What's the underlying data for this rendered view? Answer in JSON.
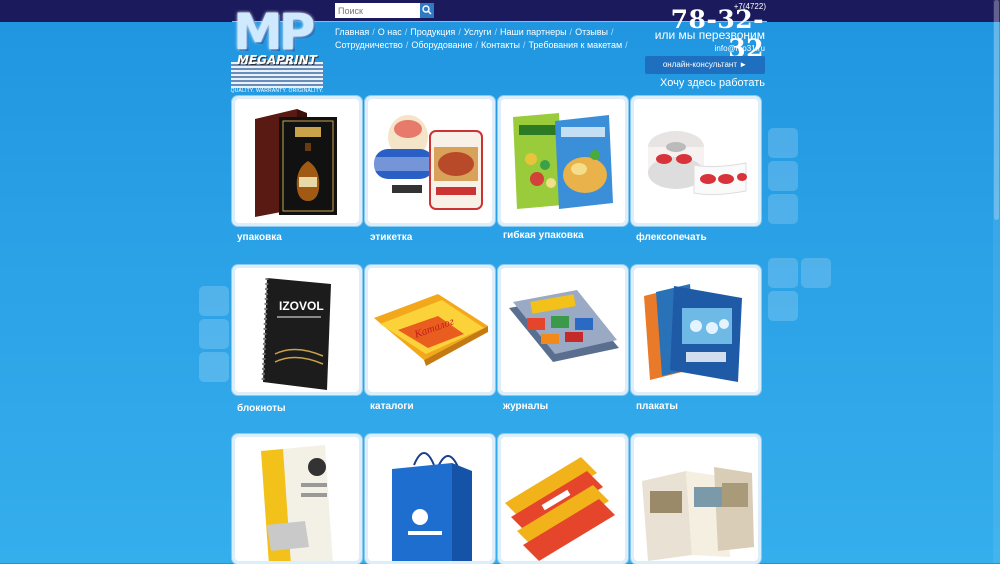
{
  "header": {
    "logo_letters": "MP",
    "logo_brand": "MEGAPRINT",
    "logo_tagline": "QUALITY. WARRANTY. ORIGINALITY.",
    "search_placeholder": "Поиск",
    "nav_row1": [
      "Главная",
      "О нас",
      "Продукция",
      "Услуги",
      "Наши партнеры",
      "Отзывы"
    ],
    "nav_row2": [
      "Сотрудничество",
      "Оборудование",
      "Контакты",
      "Требования к макетам"
    ],
    "phone_code": "+7(4722)",
    "phone_number": "78-32-32",
    "callback": "или мы перезвоним",
    "email": "info@mp31.ru",
    "consultant_button": "онлайн-консультант ►",
    "job_link": "Хочу здесь работать"
  },
  "products": [
    {
      "label": "упаковка"
    },
    {
      "label": "этикетка"
    },
    {
      "label": "гибкая упаковка"
    },
    {
      "label": "флексопечать"
    },
    {
      "label": "блокноты"
    },
    {
      "label": "каталоги"
    },
    {
      "label": "журналы"
    },
    {
      "label": "плакаты"
    },
    {
      "label": ""
    },
    {
      "label": ""
    },
    {
      "label": ""
    },
    {
      "label": ""
    }
  ],
  "colors": {
    "topbar": "#1b1a5c",
    "background": "#2aa0e6",
    "button": "#1e6fbf"
  }
}
